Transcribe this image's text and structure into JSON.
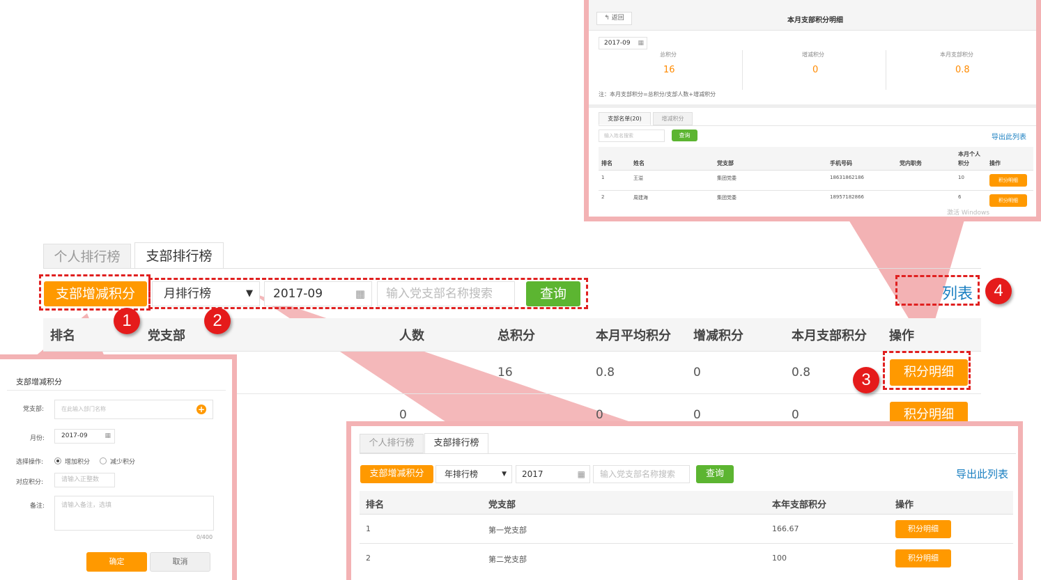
{
  "main": {
    "tabs": [
      "个人排行榜",
      "支部排行榜"
    ],
    "add_btn": "支部增减积分",
    "period_select": "月排行榜",
    "month": "2017-09",
    "search_placeholder": "输入党支部名称搜索",
    "query_btn": "查询",
    "export_partial": "列表",
    "columns": [
      "排名",
      "党支部",
      "人数",
      "总积分",
      "本月平均积分",
      "增减积分",
      "本月支部积分",
      "操作"
    ],
    "rows": [
      {
        "total": "16",
        "avg": "0.8",
        "adj": "0",
        "branch": "0.8",
        "action": "积分明细"
      },
      {
        "count": "0",
        "avg": "0",
        "adj": "0",
        "branch": "0",
        "action": "积分明细"
      }
    ]
  },
  "callouts": [
    "1",
    "2",
    "3",
    "4"
  ],
  "detail": {
    "back": "返回",
    "title": "本月支部积分明细",
    "month": "2017-09",
    "stats": [
      {
        "label": "总积分",
        "value": "16"
      },
      {
        "label": "增减积分",
        "value": "0"
      },
      {
        "label": "本月支部积分",
        "value": "0.8"
      }
    ],
    "note": "注：本月支部积分=总积分/支部人数+增减积分",
    "tabs": [
      "支部名单(20)",
      "增减积分"
    ],
    "search_placeholder": "输入姓名搜索",
    "query_btn": "查询",
    "export": "导出此列表",
    "columns": [
      "排名",
      "姓名",
      "党支部",
      "手机号码",
      "党内职务",
      "本月个人",
      "积分",
      "操作"
    ],
    "rows": [
      {
        "rank": "1",
        "name": "王溢",
        "branch": "集团党委",
        "phone": "18631862186",
        "score": "10",
        "action": "积分明细"
      },
      {
        "rank": "2",
        "name": "周建海",
        "branch": "集团党委",
        "phone": "18957182866",
        "score": "6",
        "action": "积分明细"
      }
    ],
    "watermark": "激活 Windows"
  },
  "form": {
    "title": "支部增减积分",
    "dept_label": "党支部:",
    "dept_placeholder": "在此输入部门名称",
    "month_label": "月份:",
    "month": "2017-09",
    "op_label": "选择操作:",
    "op_add": "增加积分",
    "op_sub": "减少积分",
    "score_label": "对应积分:",
    "score_placeholder": "请输入正整数",
    "remark_label": "备注:",
    "remark_placeholder": "请输入备注，选填",
    "counter": "0/400",
    "ok": "确定",
    "cancel": "取消"
  },
  "yearly": {
    "tabs": [
      "个人排行榜",
      "支部排行榜"
    ],
    "add_btn": "支部增减积分",
    "period_select": "年排行榜",
    "year": "2017",
    "search_placeholder": "输入党支部名称搜索",
    "query_btn": "查询",
    "export": "导出此列表",
    "columns": [
      "排名",
      "党支部",
      "本年支部积分",
      "操作"
    ],
    "rows": [
      {
        "rank": "1",
        "branch": "第一党支部",
        "score": "166.67",
        "action": "积分明细"
      },
      {
        "rank": "2",
        "branch": "第二党支部",
        "score": "100",
        "action": "积分明细"
      }
    ]
  },
  "colors": {
    "orange": "#ff9900",
    "green": "#5cb531",
    "red": "#e51b1b",
    "callout": "#f3b2b4",
    "link": "#1a7fc1"
  }
}
